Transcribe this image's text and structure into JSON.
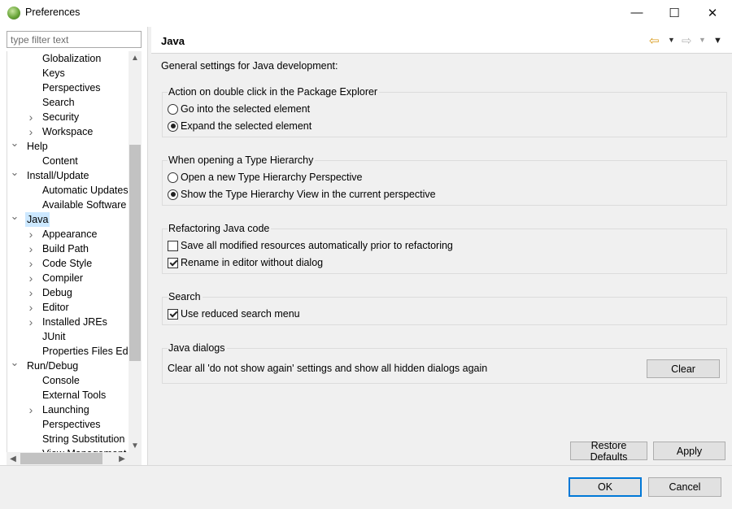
{
  "window": {
    "title": "Preferences",
    "minimize_glyph": "—",
    "maximize_glyph": "☐",
    "close_glyph": "✕"
  },
  "filter": {
    "placeholder": "type filter text",
    "value": ""
  },
  "tree": {
    "items": [
      {
        "label": "Globalization",
        "level": 2,
        "expander": "",
        "selected": false
      },
      {
        "label": "Keys",
        "level": 2,
        "expander": "",
        "selected": false
      },
      {
        "label": "Perspectives",
        "level": 2,
        "expander": "",
        "selected": false
      },
      {
        "label": "Search",
        "level": 2,
        "expander": "",
        "selected": false
      },
      {
        "label": "Security",
        "level": 2,
        "expander": "collapsed",
        "selected": false
      },
      {
        "label": "Workspace",
        "level": 2,
        "expander": "collapsed",
        "selected": false
      },
      {
        "label": "Help",
        "level": 1,
        "expander": "expanded",
        "selected": false
      },
      {
        "label": "Content",
        "level": 2,
        "expander": "",
        "selected": false
      },
      {
        "label": "Install/Update",
        "level": 1,
        "expander": "expanded",
        "selected": false
      },
      {
        "label": "Automatic Updates",
        "level": 2,
        "expander": "",
        "selected": false
      },
      {
        "label": "Available Software Sites",
        "level": 2,
        "expander": "",
        "selected": false
      },
      {
        "label": "Java",
        "level": 1,
        "expander": "expanded",
        "selected": true
      },
      {
        "label": "Appearance",
        "level": 2,
        "expander": "collapsed",
        "selected": false
      },
      {
        "label": "Build Path",
        "level": 2,
        "expander": "collapsed",
        "selected": false
      },
      {
        "label": "Code Style",
        "level": 2,
        "expander": "collapsed",
        "selected": false
      },
      {
        "label": "Compiler",
        "level": 2,
        "expander": "collapsed",
        "selected": false
      },
      {
        "label": "Debug",
        "level": 2,
        "expander": "collapsed",
        "selected": false
      },
      {
        "label": "Editor",
        "level": 2,
        "expander": "collapsed",
        "selected": false
      },
      {
        "label": "Installed JREs",
        "level": 2,
        "expander": "collapsed",
        "selected": false
      },
      {
        "label": "JUnit",
        "level": 2,
        "expander": "",
        "selected": false
      },
      {
        "label": "Properties Files Editor",
        "level": 2,
        "expander": "",
        "selected": false
      },
      {
        "label": "Run/Debug",
        "level": 1,
        "expander": "expanded",
        "selected": false
      },
      {
        "label": "Console",
        "level": 2,
        "expander": "",
        "selected": false
      },
      {
        "label": "External Tools",
        "level": 2,
        "expander": "",
        "selected": false
      },
      {
        "label": "Launching",
        "level": 2,
        "expander": "collapsed",
        "selected": false
      },
      {
        "label": "Perspectives",
        "level": 2,
        "expander": "",
        "selected": false
      },
      {
        "label": "String Substitution",
        "level": 2,
        "expander": "",
        "selected": false
      },
      {
        "label": "View Management",
        "level": 2,
        "expander": "",
        "selected": false
      }
    ]
  },
  "page": {
    "title": "Java",
    "description": "General settings for Java development:",
    "icons": {
      "back": "⇦",
      "back_dropdown": "▼",
      "forward": "⇨",
      "forward_dropdown": "▼",
      "view_menu": "▼"
    },
    "groups": {
      "double_click": {
        "title": "Action on double click in the Package Explorer",
        "options": [
          "Go into the selected element",
          "Expand the selected element"
        ],
        "selected": 1
      },
      "type_hierarchy": {
        "title": "When opening a Type Hierarchy",
        "options": [
          "Open a new Type Hierarchy Perspective",
          "Show the Type Hierarchy View in the current perspective"
        ],
        "selected": 1
      },
      "refactoring": {
        "title": "Refactoring Java code",
        "options": [
          {
            "label": "Save all modified resources automatically prior to refactoring",
            "checked": false
          },
          {
            "label": "Rename in editor without dialog",
            "checked": true
          }
        ]
      },
      "search": {
        "title": "Search",
        "options": [
          {
            "label": "Use reduced search menu",
            "checked": true
          }
        ]
      },
      "dialogs": {
        "title": "Java dialogs",
        "text": "Clear all 'do not show again' settings and show all hidden dialogs again",
        "clear_label": "Clear"
      }
    },
    "restore_defaults_label": "Restore Defaults",
    "apply_label": "Apply"
  },
  "footer": {
    "ok_label": "OK",
    "cancel_label": "Cancel"
  },
  "colors": {
    "selection": "#cce8ff",
    "panel": "#f0f0f0",
    "default_button_border": "#0078d7"
  }
}
